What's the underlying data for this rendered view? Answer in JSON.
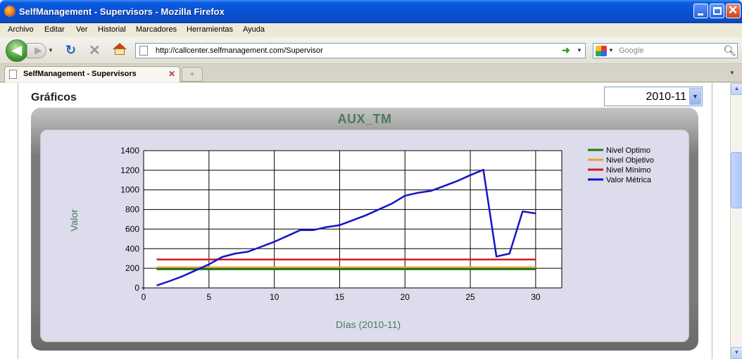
{
  "window": {
    "title": "SelfManagement - Supervisors - Mozilla Firefox"
  },
  "menu": {
    "items": [
      "Archivo",
      "Editar",
      "Ver",
      "Historial",
      "Marcadores",
      "Herramientas",
      "Ayuda"
    ]
  },
  "navbar": {
    "url": "http://callcenter.selfmanagement.com/Supervisor",
    "search_placeholder": "Google"
  },
  "tabs": {
    "active_label": "SelfManagement - Supervisors"
  },
  "page": {
    "section_title": "Gráficos",
    "month_selected": "2010-11"
  },
  "chart_data": {
    "type": "line",
    "title": "AUX_TM",
    "xlabel": "Días (2010-11)",
    "ylabel": "Valor",
    "xlim": [
      0,
      32
    ],
    "ylim": [
      0,
      1400
    ],
    "x_ticks": [
      0,
      5,
      10,
      15,
      20,
      25,
      30
    ],
    "y_ticks": [
      0,
      200,
      400,
      600,
      800,
      1000,
      1200,
      1400
    ],
    "grid": true,
    "legend_position": "right",
    "series": [
      {
        "name": "Nivel Optimo",
        "color": "#1a7a1a",
        "x": [
          1,
          30
        ],
        "y": [
          190,
          190
        ]
      },
      {
        "name": "Nivel Objetivo",
        "color": "#e8a03c",
        "x": [
          1,
          30
        ],
        "y": [
          210,
          210
        ]
      },
      {
        "name": "Nivel Mínimo",
        "color": "#d81818",
        "x": [
          1,
          30
        ],
        "y": [
          290,
          290
        ]
      },
      {
        "name": "Valor Métrica",
        "color": "#1414c8",
        "x": [
          1,
          2,
          3,
          4,
          5,
          6,
          7,
          8,
          9,
          10,
          11,
          12,
          13,
          14,
          15,
          16,
          17,
          18,
          19,
          20,
          21,
          22,
          23,
          24,
          25,
          26,
          27,
          28,
          29,
          30
        ],
        "y": [
          25,
          70,
          120,
          180,
          240,
          315,
          350,
          370,
          420,
          470,
          530,
          590,
          590,
          620,
          640,
          690,
          740,
          800,
          860,
          940,
          970,
          990,
          1040,
          1090,
          1150,
          1205,
          320,
          350,
          780,
          760
        ]
      }
    ]
  }
}
